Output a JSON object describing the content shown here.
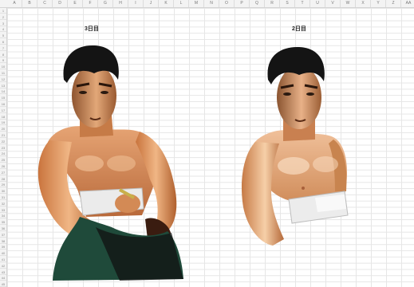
{
  "sheet": {
    "columns": [
      "A",
      "B",
      "C",
      "D",
      "E",
      "F",
      "G",
      "H",
      "I",
      "J",
      "K",
      "L",
      "M",
      "N",
      "O",
      "P",
      "Q",
      "R",
      "S",
      "T",
      "U",
      "V",
      "W",
      "X",
      "Y",
      "Z",
      "AA"
    ],
    "rows": [
      "1",
      "2",
      "3",
      "4",
      "5",
      "6",
      "7",
      "8",
      "9",
      "10",
      "11",
      "12",
      "13",
      "14",
      "15",
      "16",
      "17",
      "18",
      "19",
      "20",
      "21",
      "22",
      "23",
      "24",
      "25",
      "26",
      "27",
      "28",
      "29",
      "30",
      "31",
      "32",
      "33",
      "34",
      "35",
      "36",
      "37",
      "38",
      "39",
      "40",
      "41",
      "42",
      "43",
      "44",
      "45"
    ]
  },
  "labels": {
    "day3": "3日目",
    "day2": "2日目"
  },
  "colors": {
    "skin": "#d9935f",
    "skin_light": "#f2c29a",
    "skin_shadow": "#8a4f2a",
    "hair": "#141414",
    "sarashi": "#e9e9e9",
    "hakama": "#1f4a3a",
    "grid": "#e6e6e6"
  },
  "icons": {
    "illustration_day3": "man-figure-icon",
    "illustration_day2": "man-figure-icon"
  }
}
